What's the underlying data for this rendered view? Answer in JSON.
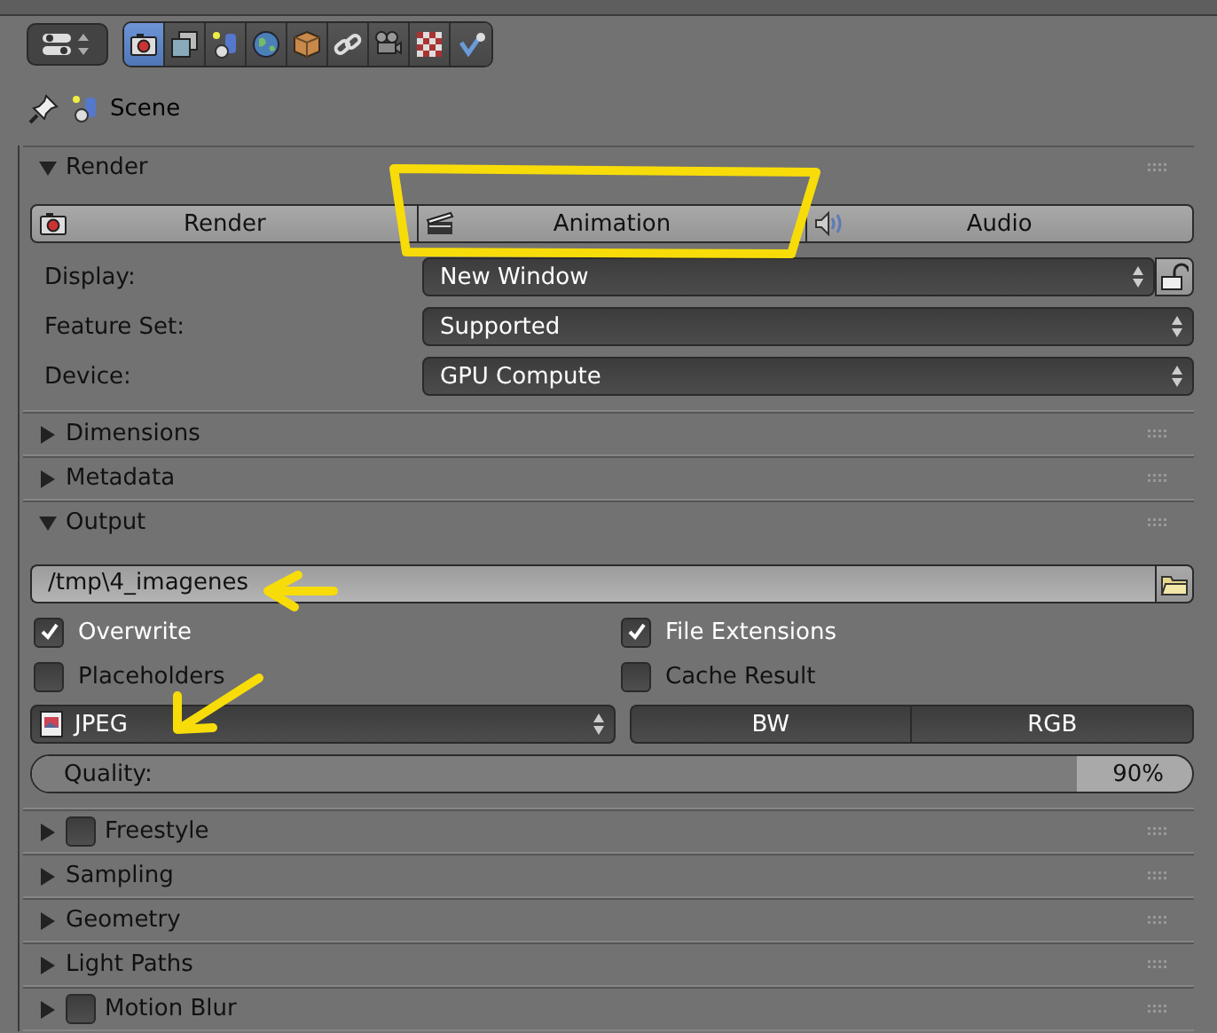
{
  "editor_button": {
    "kind": "properties"
  },
  "tabs": [
    {
      "kind": "camera",
      "selected": true
    },
    {
      "kind": "layers",
      "selected": false
    },
    {
      "kind": "scene",
      "selected": false
    },
    {
      "kind": "globe",
      "selected": false
    },
    {
      "kind": "cube",
      "selected": false
    },
    {
      "kind": "link",
      "selected": false
    },
    {
      "kind": "film",
      "selected": false
    },
    {
      "kind": "checker",
      "selected": false
    },
    {
      "kind": "brush",
      "selected": false
    }
  ],
  "breadcrumb": {
    "label": "Scene"
  },
  "panels": [
    {
      "kind": "render",
      "title": "Render",
      "expanded": true,
      "buttons": [
        {
          "label": "Render",
          "kind": "camera"
        },
        {
          "label": "Animation",
          "kind": "clapper"
        },
        {
          "label": "Audio",
          "kind": "speaker"
        }
      ],
      "fields": [
        {
          "label": "Display:",
          "value": "New Window",
          "locked": false
        },
        {
          "label": "Feature Set:",
          "value": "Supported"
        },
        {
          "label": "Device:",
          "value": "GPU Compute"
        }
      ]
    },
    {
      "kind": "plain",
      "title": "Dimensions",
      "expanded": false
    },
    {
      "kind": "plain",
      "title": "Metadata",
      "expanded": false
    },
    {
      "kind": "output",
      "title": "Output",
      "expanded": true,
      "path": "/tmp\\4_imagenes",
      "options": [
        {
          "label": "Overwrite",
          "checked": true
        },
        {
          "label": "File Extensions",
          "checked": true
        },
        {
          "label": "Placeholders",
          "checked": false
        },
        {
          "label": "Cache Result",
          "checked": false
        }
      ],
      "format": "JPEG",
      "color_modes": [
        {
          "label": "BW",
          "selected": false
        },
        {
          "label": "RGB",
          "selected": false
        }
      ],
      "quality": {
        "label": "Quality:",
        "reading": "90%",
        "level": 0.9
      }
    },
    {
      "kind": "plain",
      "title": "Freestyle",
      "expanded": false,
      "enabled": false
    },
    {
      "kind": "plain",
      "title": "Sampling",
      "expanded": false
    },
    {
      "kind": "plain",
      "title": "Geometry",
      "expanded": false
    },
    {
      "kind": "plain",
      "title": "Light Paths",
      "expanded": false
    },
    {
      "kind": "plain",
      "title": "Motion Blur",
      "expanded": false,
      "enabled": false
    }
  ],
  "annotations": [
    {
      "kind": "rectangle"
    },
    {
      "kind": "arrow-left"
    },
    {
      "kind": "arrow-down-left"
    }
  ]
}
